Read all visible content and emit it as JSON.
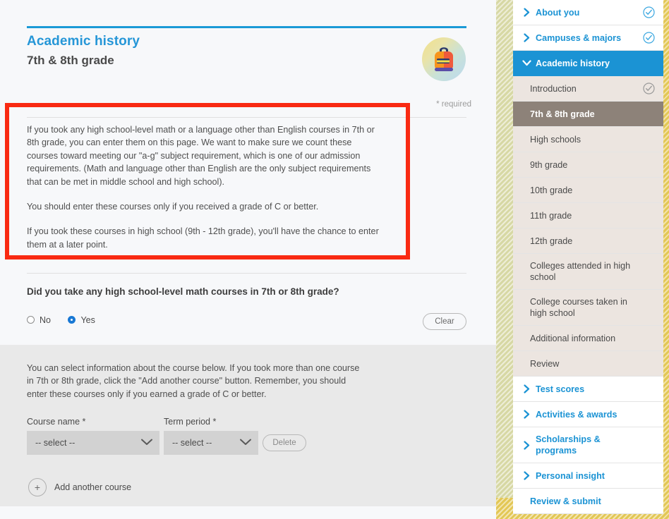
{
  "page": {
    "eyebrow_title": "Academic history",
    "sub_title": "7th & 8th grade",
    "required_note": "* required",
    "badge_icon": "backpack-icon"
  },
  "intro": {
    "paragraphs": [
      "If you took any high school-level math or a language other than English courses in 7th or 8th grade, you can enter them on this page. We want to make sure we count these courses toward meeting our \"a-g\" subject requirement, which is one of our admission requirements. (Math and language other than English are the only subject requirements that can be met in middle school and high school).",
      "You should enter these courses only if you received a grade of C or better.",
      "If you took these courses in high school (9th - 12th grade), you'll have the chance to enter them at a later point."
    ]
  },
  "question": {
    "text": "Did you take any high school-level math courses in 7th or 8th grade?",
    "options": [
      {
        "label": "No",
        "selected": false
      },
      {
        "label": "Yes",
        "selected": true
      }
    ],
    "clear_label": "Clear"
  },
  "course_form": {
    "description": "You can select information about the course below. If you took more than one course in 7th or 8th grade, click the \"Add another course\" button. Remember, you should enter these courses only if you earned a grade of C or better.",
    "course_name_label": "Course name *",
    "course_name_value": "-- select --",
    "term_period_label": "Term period *",
    "term_period_value": "-- select --",
    "delete_label": "Delete",
    "add_another_label": "Add another course",
    "add_icon": "plus-icon",
    "chevron_icon": "chevron-down-icon"
  },
  "sidebar": {
    "items": [
      {
        "label": "About you",
        "type": "top",
        "icon": "chevron-right-icon",
        "check": "blue"
      },
      {
        "label": "Campuses & majors",
        "type": "top",
        "icon": "chevron-right-icon",
        "check": "blue"
      },
      {
        "label": "Academic history",
        "type": "expanded",
        "icon": "chevron-down-icon",
        "check": "none"
      },
      {
        "label": "Introduction",
        "type": "sub",
        "icon": "none",
        "check": "gray"
      },
      {
        "label": "7th & 8th grade",
        "type": "sub-active",
        "icon": "none",
        "check": "none"
      },
      {
        "label": "High schools",
        "type": "sub",
        "icon": "none",
        "check": "none"
      },
      {
        "label": "9th grade",
        "type": "sub",
        "icon": "none",
        "check": "none"
      },
      {
        "label": "10th grade",
        "type": "sub",
        "icon": "none",
        "check": "none"
      },
      {
        "label": "11th grade",
        "type": "sub",
        "icon": "none",
        "check": "none"
      },
      {
        "label": "12th grade",
        "type": "sub",
        "icon": "none",
        "check": "none"
      },
      {
        "label": "Colleges attended in high school",
        "type": "sub",
        "icon": "none",
        "check": "none"
      },
      {
        "label": "College courses taken in high school",
        "type": "sub",
        "icon": "none",
        "check": "none"
      },
      {
        "label": "Additional information",
        "type": "sub",
        "icon": "none",
        "check": "none"
      },
      {
        "label": "Review",
        "type": "sub",
        "icon": "none",
        "check": "none"
      },
      {
        "label": "Test scores",
        "type": "top",
        "icon": "chevron-right-icon",
        "check": "none"
      },
      {
        "label": "Activities & awards",
        "type": "top",
        "icon": "chevron-right-icon",
        "check": "none"
      },
      {
        "label": "Scholarships & programs",
        "type": "top",
        "icon": "chevron-right-icon",
        "check": "none"
      },
      {
        "label": "Personal insight",
        "type": "top",
        "icon": "chevron-right-icon",
        "check": "none"
      },
      {
        "label": "Review & submit",
        "type": "plain",
        "icon": "none",
        "check": "none"
      }
    ]
  },
  "colors": {
    "brand_blue": "#1b93d4",
    "active_sub": "#8d8279",
    "sub_bg": "#ece5e0",
    "annotation_red": "#f92a12",
    "stripe_olive": "#d7d8a4",
    "stripe_gold": "#e3c755"
  }
}
